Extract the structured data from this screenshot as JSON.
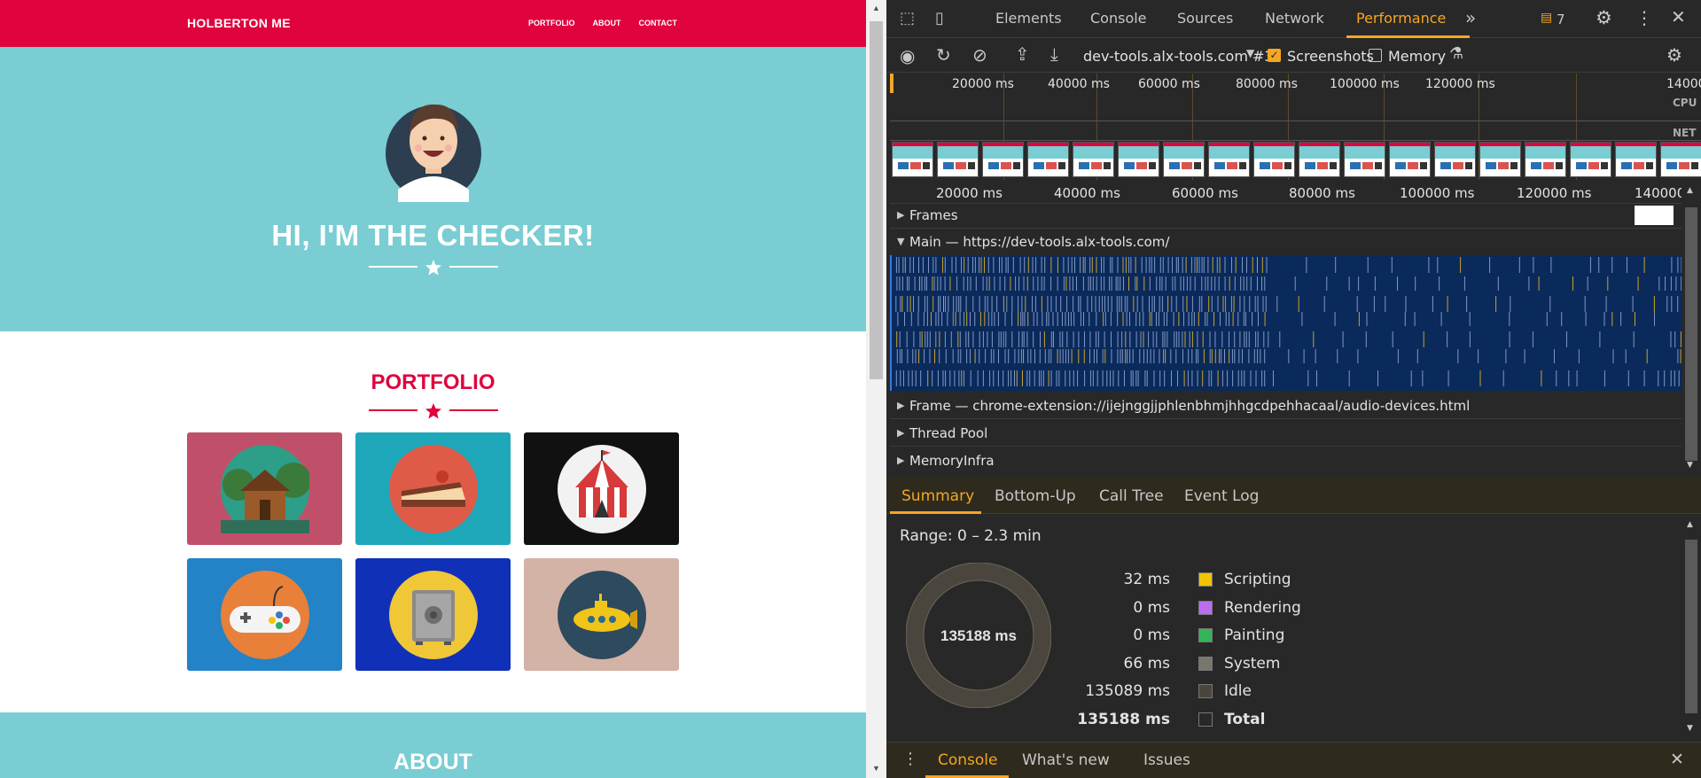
{
  "site": {
    "brand": "HOLBERTON ME",
    "nav": [
      "PORTFOLIO",
      "ABOUT",
      "CONTACT"
    ],
    "hero_title": "HI, I'M THE CHECKER!",
    "portfolio_title": "PORTFOLIO",
    "about_title": "ABOUT",
    "tiles": [
      {
        "name": "cabin",
        "bg": "#c0506a",
        "circle": "#2d9e87"
      },
      {
        "name": "cake",
        "bg": "#1fa7ba",
        "circle": "#e05a48"
      },
      {
        "name": "circus-tent",
        "bg": "#111111",
        "circle": "#f2f2f2"
      },
      {
        "name": "game-controller",
        "bg": "#2383c6",
        "circle": "#e8803a"
      },
      {
        "name": "safe",
        "bg": "#1030b8",
        "circle": "#f0c737"
      },
      {
        "name": "submarine",
        "bg": "#d2b3a6",
        "circle": "#2d4a5e"
      }
    ],
    "colors": {
      "red": "#e0033d",
      "teal": "#79cdd3"
    }
  },
  "devtools": {
    "tabs": [
      "Elements",
      "Console",
      "Sources",
      "Network",
      "Performance"
    ],
    "active_tab": "Performance",
    "issues_count": "7",
    "toolbar": {
      "target": "dev-tools.alx-tools.com #3",
      "screenshots_label": "Screenshots",
      "screenshots_checked": true,
      "memory_label": "Memory",
      "memory_checked": false
    },
    "overview": {
      "ticks": [
        "20000 ms",
        "40000 ms",
        "60000 ms",
        "80000 ms",
        "100000 ms",
        "120000 ms",
        "14000"
      ],
      "cpu_label": "CPU",
      "net_label": "NET"
    },
    "ruler_ticks": [
      "20000 ms",
      "40000 ms",
      "60000 ms",
      "80000 ms",
      "100000 ms",
      "120000 ms",
      "140000"
    ],
    "tracks": {
      "frames": "Frames",
      "main": "Main — https://dev-tools.alx-tools.com/",
      "frame": "Frame — chrome-extension://ijejnggjjphlenbhmjhhgcdpehhacaal/audio-devices.html",
      "thread_pool": "Thread Pool",
      "memory_infra": "MemoryInfra"
    },
    "bottom_tabs": [
      "Summary",
      "Bottom-Up",
      "Call Tree",
      "Event Log"
    ],
    "summary": {
      "range": "Range: 0 – 2.3 min",
      "total_center": "135188 ms",
      "rows": [
        {
          "value": "32 ms",
          "label": "Scripting",
          "color": "#f2c300"
        },
        {
          "value": "0 ms",
          "label": "Rendering",
          "color": "#b96ef2"
        },
        {
          "value": "0 ms",
          "label": "Painting",
          "color": "#34b45a"
        },
        {
          "value": "66 ms",
          "label": "System",
          "color": "#7b766c"
        },
        {
          "value": "135089 ms",
          "label": "Idle",
          "color": "#4a463d"
        },
        {
          "value": "135188 ms",
          "label": "Total",
          "color": "#282828"
        }
      ]
    },
    "drawer_tabs": [
      "Console",
      "What's new",
      "Issues"
    ]
  }
}
